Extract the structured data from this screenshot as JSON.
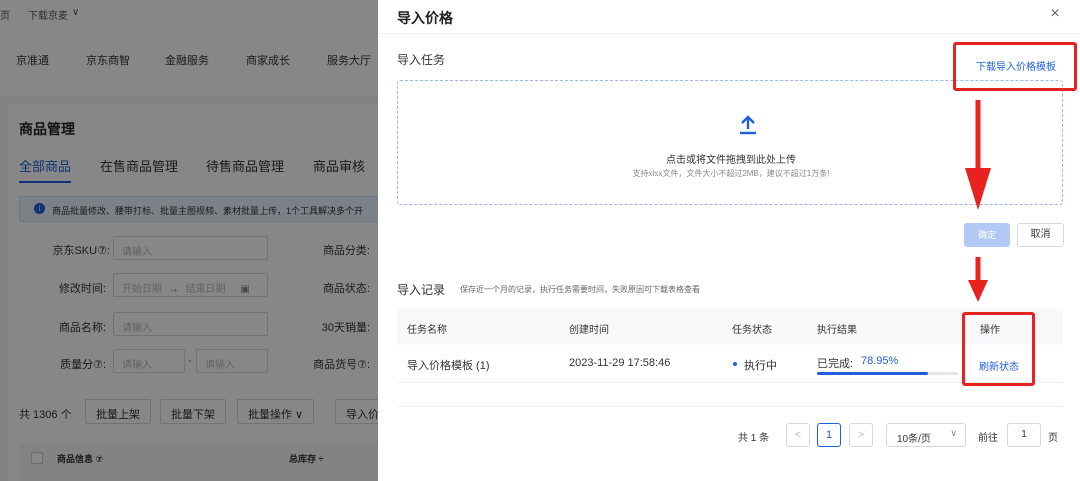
{
  "background": {
    "top_links": [
      "页",
      "下载京麦"
    ],
    "nav": [
      "京准通",
      "京东商智",
      "金融服务",
      "商家成长",
      "服务大厅"
    ],
    "page_title": "商品管理",
    "tabs": [
      "全部商品",
      "在售商品管理",
      "待售商品管理",
      "商品审核"
    ],
    "notice": "商品批量修改、腰带打标、批量主图视频、素材批量上传，1个工具解决多个开",
    "filters": {
      "sku_label": "京东SKU⑦:",
      "sku_placeholder": "请输入",
      "category_label": "商品分类:",
      "modified_label": "修改时间:",
      "start_date": "开始日期",
      "arrow": "→",
      "end_date": "结束日期",
      "status_label": "商品状态:",
      "name_label": "商品名称:",
      "name_placeholder": "请输入",
      "sales_label": "30天销量:",
      "quality_label": "质量分⑦:",
      "quality_min": "请输入",
      "dash": "-",
      "quality_max": "请输入",
      "code_label": "商品货号⑦:"
    },
    "toolbar": {
      "count": "共 1306 个",
      "buttons": [
        "批量上架",
        "批量下架",
        "批量操作 ∨",
        "导入价"
      ]
    },
    "table_head": {
      "info": "商品信息 ⑦",
      "stock": "总库存 ÷"
    }
  },
  "drawer": {
    "title": "导入价格",
    "close": "×",
    "task_section": "导入任务",
    "download_template": "下载导入价格模板",
    "upload": {
      "main_text": "点击或将文件拖拽到此处上传",
      "hint": "支持xlsx文件，文件大小不超过2MB，建议不超过1万条!"
    },
    "confirm": "确定",
    "cancel": "取消",
    "records_title": "导入记录",
    "records_hint": "保存近一个月的记录，执行任务需要时间，失败原因可下载表格查看",
    "columns": [
      "任务名称",
      "创建时间",
      "任务状态",
      "执行结果",
      "操作"
    ],
    "row": {
      "name": "导入价格模板 (1)",
      "created": "2023-11-29 17:58:46",
      "status": "执行中",
      "result_label": "已完成:",
      "result_value": "78.95%",
      "progress": 0.7895,
      "action": "刷新状态"
    },
    "pagination": {
      "total": "共 1 条",
      "prev": "<",
      "current": "1",
      "next": ">",
      "page_size": "10条/页",
      "goto": "前往",
      "goto_value": "1",
      "page_unit": "页"
    }
  },
  "colors": {
    "accent": "#1e5fe0",
    "annotation": "#e8231f"
  }
}
